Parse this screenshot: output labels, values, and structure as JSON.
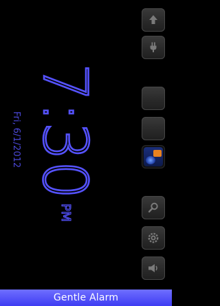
{
  "clock": {
    "date": "Fri, 6/1/2012",
    "time": "7:30",
    "ampm": "PM"
  },
  "alarm": {
    "label": "Gentle Alarm"
  },
  "buttons": {
    "items": [
      {
        "icon": "arrow-up-icon"
      },
      {
        "icon": "plug-icon"
      },
      {
        "icon": "blank-icon"
      },
      {
        "icon": "blank-icon"
      },
      {
        "icon": "app-icon"
      },
      {
        "icon": "search-icon"
      },
      {
        "icon": "settings-icon"
      },
      {
        "icon": "speaker-icon"
      }
    ]
  },
  "colors": {
    "accent": "#5552ff",
    "bar": "#4b49f5",
    "background": "#000000"
  }
}
